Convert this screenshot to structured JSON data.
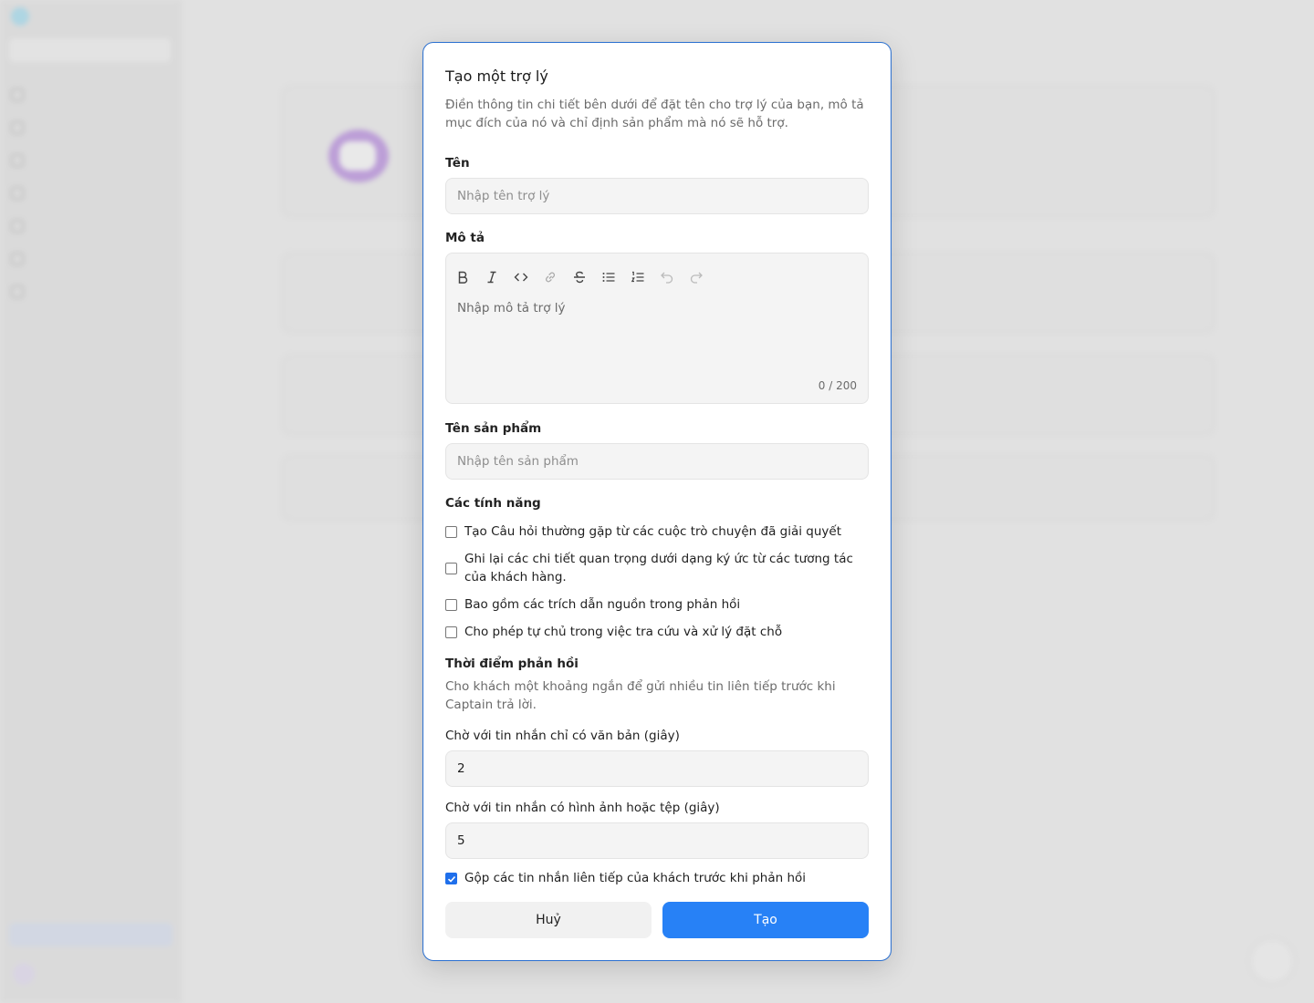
{
  "modal": {
    "title": "Tạo một trợ lý",
    "description": "Điền thông tin chi tiết bên dưới để đặt tên cho trợ lý của bạn, mô tả mục đích của nó và chỉ định sản phẩm mà nó sẽ hỗ trợ.",
    "name": {
      "label": "Tên",
      "placeholder": "Nhập tên trợ lý",
      "value": ""
    },
    "description_field": {
      "label": "Mô tả",
      "placeholder": "Nhập mô tả trợ lý",
      "counter": "0 / 200",
      "toolbar": [
        "bold-icon",
        "italic-icon",
        "code-icon",
        "link-icon",
        "strikethrough-icon",
        "bullet-list-icon",
        "numbered-list-icon",
        "undo-icon",
        "redo-icon"
      ]
    },
    "product": {
      "label": "Tên sản phẩm",
      "placeholder": "Nhập tên sản phẩm",
      "value": ""
    },
    "features": {
      "label": "Các tính năng",
      "items": [
        {
          "label": "Tạo Câu hỏi thường gặp từ các cuộc trò chuyện đã giải quyết",
          "checked": false
        },
        {
          "label": "Ghi lại các chi tiết quan trọng dưới dạng ký ức từ các tương tác của khách hàng.",
          "checked": false
        },
        {
          "label": "Bao gồm các trích dẫn nguồn trong phản hồi",
          "checked": false
        },
        {
          "label": "Cho phép tự chủ trong việc tra cứu và xử lý đặt chỗ",
          "checked": false
        }
      ]
    },
    "timing": {
      "title": "Thời điểm phản hồi",
      "description": "Cho khách một khoảng ngắn để gửi nhiều tin liên tiếp trước khi Captain trả lời.",
      "text_wait": {
        "label": "Chờ với tin nhắn chỉ có văn bản (giây)",
        "value": "2"
      },
      "media_wait": {
        "label": "Chờ với tin nhắn có hình ảnh hoặc tệp (giây)",
        "value": "5"
      },
      "merge": {
        "label": "Gộp các tin nhắn liên tiếp của khách trước khi phản hồi",
        "checked": true
      }
    },
    "buttons": {
      "cancel": "Huỷ",
      "create": "Tạo"
    }
  },
  "colors": {
    "accent": "#2781f6",
    "modal_border": "#2a6fcf"
  }
}
